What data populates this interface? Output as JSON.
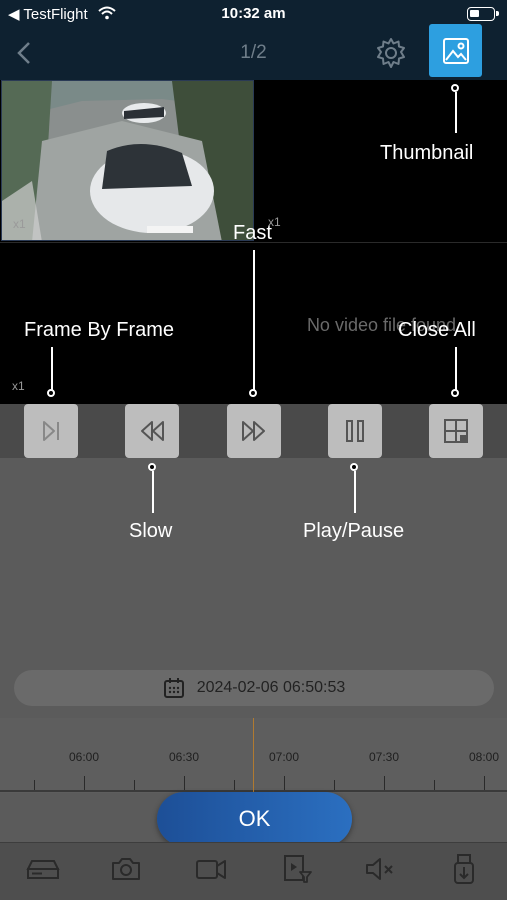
{
  "status_bar": {
    "back_app": "◀ TestFlight",
    "time": "10:32 am"
  },
  "nav": {
    "page_indicator": "1/2"
  },
  "video": {
    "cell1_scale": "x1",
    "cell2_scale": "x1",
    "cell3_scale": "x1",
    "no_video_text": "No video file found"
  },
  "callouts": {
    "thumbnail": "Thumbnail",
    "fast": "Fast",
    "frame_by_frame": "Frame By Frame",
    "close_all": "Close All",
    "slow": "Slow",
    "play_pause": "Play/Pause"
  },
  "date": {
    "value": "2024-02-06 06:50:53"
  },
  "timeline": {
    "ticks": [
      "06:00",
      "06:30",
      "07:00",
      "07:30",
      "08:00"
    ]
  },
  "ok_label": "OK",
  "bottom_bar": {
    "icons": [
      "nvr-icon",
      "camera-icon",
      "video-record-icon",
      "playback-filter-icon",
      "mute-icon",
      "usb-backup-icon"
    ]
  },
  "colors": {
    "accent": "#2d9fe0",
    "ok_button": "#2b6fc0",
    "timeline_cursor": "#b07a30"
  }
}
